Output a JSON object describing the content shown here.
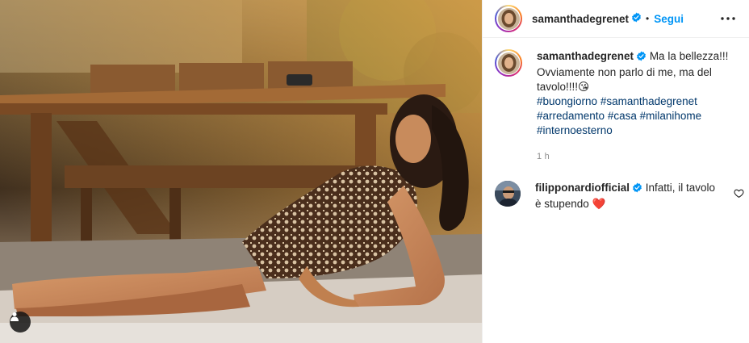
{
  "post": {
    "image_alt": "",
    "tag_icon": "user-tag-icon"
  },
  "header": {
    "username": "samanthadegrenet",
    "separator": "•",
    "follow_label": "Segui",
    "more_icon": "more-options-icon"
  },
  "caption": {
    "username": "samanthadegrenet",
    "text": "Ma la bellezza!!! Ovviamente non parlo di me, ma del tavolo!!!!",
    "emoji": "😘",
    "hashtags": [
      "#buongiorno",
      "#samanthadegrenet",
      "#arredamento",
      "#casa",
      "#milanihome",
      "#internoesterno"
    ],
    "timestamp": "1 h"
  },
  "comments": [
    {
      "username": "filipponardiofficial",
      "text": "Infatti, il tavolo è stupendo",
      "emoji": "❤️"
    }
  ],
  "colors": {
    "link": "#0095f6",
    "hashtag": "#00376b",
    "verified": "#0095f6",
    "muted": "#8e8e8e",
    "heart": "#ed4956"
  }
}
